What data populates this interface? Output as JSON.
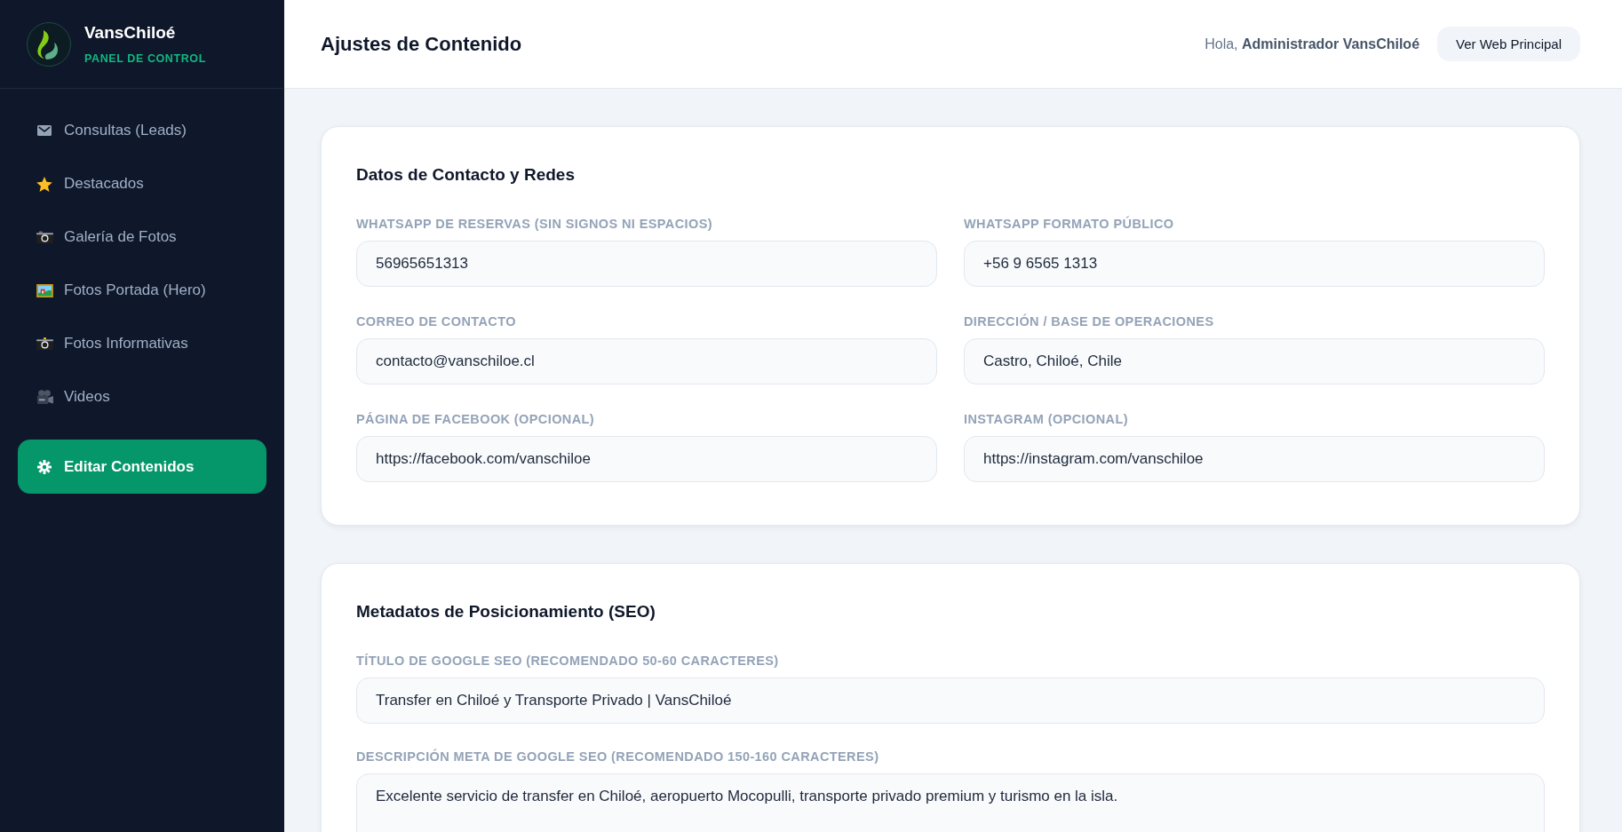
{
  "sidebar": {
    "brand": {
      "name": "VansChiloé",
      "subtitle": "PANEL DE CONTROL"
    },
    "items": [
      {
        "label": "Consultas (Leads)",
        "selected": false
      },
      {
        "label": "Destacados",
        "selected": false
      },
      {
        "label": "Galería de Fotos",
        "selected": false
      },
      {
        "label": "Fotos Portada (Hero)",
        "selected": false
      },
      {
        "label": "Fotos Informativas",
        "selected": false
      },
      {
        "label": "Videos",
        "selected": false
      },
      {
        "label": "Editar Contenidos",
        "selected": true
      }
    ]
  },
  "header": {
    "title": "Ajustes de Contenido",
    "greeting": "Hola, **Administrador VansChiloé**",
    "button": "Ver Web Principal"
  },
  "sections": [
    {
      "title": "Datos de Contacto y Redes",
      "kind": "grid",
      "fields": [
        {
          "label": "WHATSAPP DE RESERVAS (SIN SIGNOS NI ESPACIOS)",
          "value": "56965651313",
          "kind": "input"
        },
        {
          "label": "WHATSAPP FORMATO PÚBLICO",
          "value": "+56 9 6565 1313",
          "kind": "input"
        },
        {
          "label": "CORREO DE CONTACTO",
          "value": "contacto@vanschiloe.cl",
          "kind": "input"
        },
        {
          "label": "DIRECCIÓN / BASE DE OPERACIONES",
          "value": "Castro, Chiloé, Chile",
          "kind": "input"
        },
        {
          "label": "PÁGINA DE FACEBOOK (OPCIONAL)",
          "value": "https://facebook.com/vanschiloe",
          "kind": "input"
        },
        {
          "label": "INSTAGRAM (OPCIONAL)",
          "value": "https://instagram.com/vanschiloe",
          "kind": "input"
        }
      ]
    },
    {
      "title": "Metadatos de Posicionamiento (SEO)",
      "kind": "stack",
      "fields": [
        {
          "label": "TÍTULO DE GOOGLE SEO (RECOMENDADO 50-60 CARACTERES)",
          "value": "Transfer en Chiloé y Transporte Privado | VansChiloé",
          "kind": "input"
        },
        {
          "label": "DESCRIPCIÓN META DE GOOGLE SEO (RECOMENDADO 150-160 CARACTERES)",
          "value": "Excelente servicio de transfer en Chiloé, aeropuerto Mocopulli, transporte privado premium y turismo en la isla.",
          "kind": "textarea"
        }
      ]
    }
  ]
}
